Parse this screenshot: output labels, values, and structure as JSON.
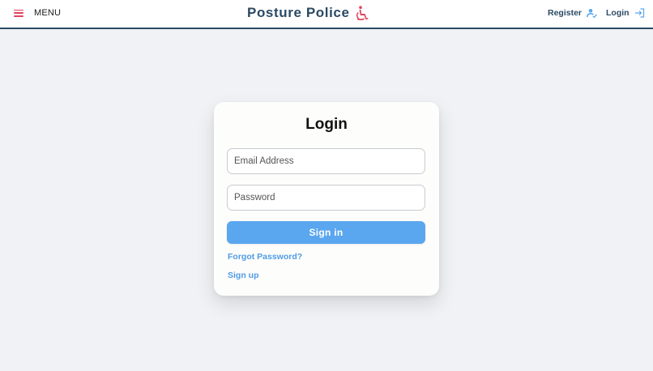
{
  "navbar": {
    "menu_label": "MENU",
    "brand_title": "Posture Police",
    "brand_icon": "wheelchair-icon",
    "register_label": "Register",
    "register_icon": "user-check-icon",
    "login_label": "Login",
    "login_icon": "login-arrow-icon"
  },
  "login_card": {
    "title": "Login",
    "email_placeholder": "Email Address",
    "email_value": "",
    "password_placeholder": "Password",
    "password_value": "",
    "signin_label": "Sign in",
    "forgot_label": "Forgot Password?",
    "signup_label": "Sign up"
  },
  "colors": {
    "brand": "#2b4a63",
    "accent_red": "#e0435c",
    "primary_button": "#5aa6ef",
    "link": "#4f9be6",
    "background": "#f0f2f5"
  }
}
